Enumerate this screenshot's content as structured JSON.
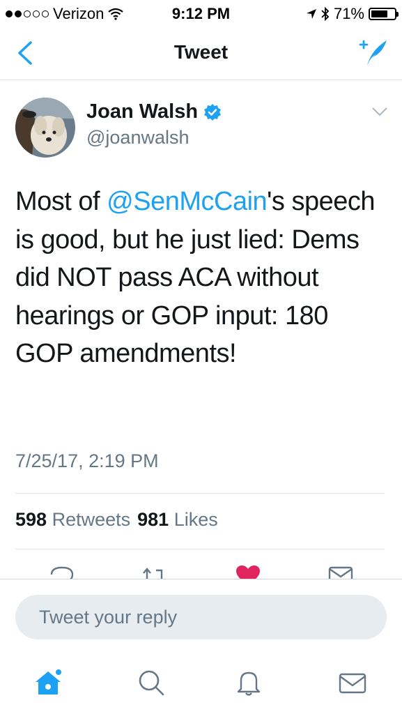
{
  "status_bar": {
    "carrier": "Verizon",
    "time": "9:12 PM",
    "battery": "71%",
    "battery_level": 0.71,
    "signal_bars": 2
  },
  "nav": {
    "title": "Tweet",
    "back_icon": "chevron-left-icon",
    "compose_icon": "compose-tweet-icon"
  },
  "tweet": {
    "author_name": "Joan Walsh",
    "author_handle": "@joanwalsh",
    "verified": true,
    "text_parts": {
      "p1": "Most of ",
      "mention": "@SenMcCain",
      "p2": "'s speech is good, but he just lied: Dems did NOT pass ACA without hearings or GOP input: 180 GOP amendments!"
    },
    "timestamp": "7/25/17, 2:19 PM",
    "retweets_count": "598",
    "retweets_label": "Retweets",
    "likes_count": "981",
    "likes_label": "Likes"
  },
  "reply": {
    "placeholder": "Tweet your reply"
  },
  "tab_bar": {
    "items": [
      "home-icon",
      "search-icon",
      "notifications-icon",
      "messages-icon"
    ]
  },
  "colors": {
    "accent": "#1da1f2",
    "like": "#e0245e",
    "secondary_text": "#657786"
  }
}
